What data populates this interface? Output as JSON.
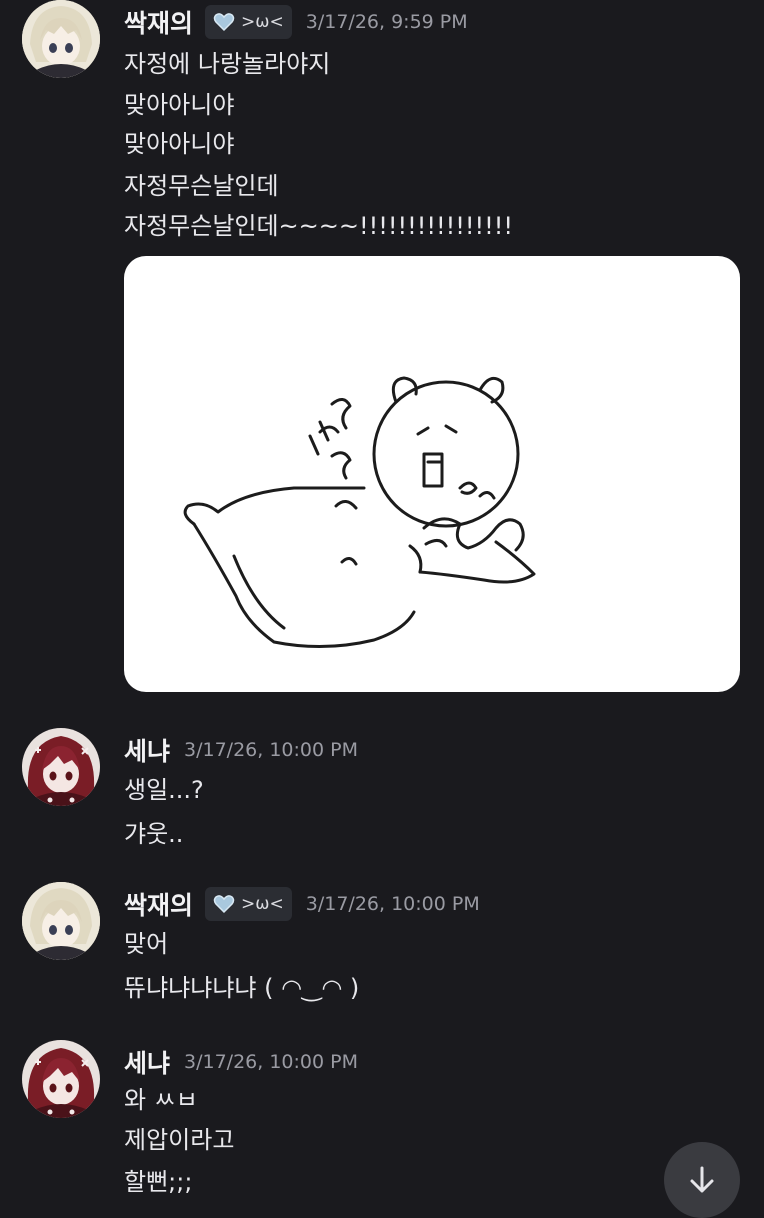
{
  "groups": [
    {
      "username": "싹재의",
      "badge": ">ω<",
      "timestamp": "3/17/26, 9:59 PM",
      "lines": [
        "자정에 나랑놀라야지",
        "맞아아니야",
        "맞아아니야",
        "자정무슨날인데",
        "자정무슨날인데~~~~!!!!!!!!!!!!!!!!"
      ]
    },
    {
      "username": "세냐",
      "timestamp": "3/17/26, 10:00 PM",
      "lines": [
        "생일...?",
        "갸웃.."
      ]
    },
    {
      "username": "싹재의",
      "badge": ">ω<",
      "timestamp": "3/17/26, 10:00 PM",
      "lines": [
        "맞어",
        "뜌냐냐냐냐냐 ( ◠‿◠ )"
      ]
    },
    {
      "username": "세냐",
      "timestamp": "3/17/26, 10:00 PM",
      "lines": [
        "와 ㅆㅂ",
        "제압이라고",
        "할뻔;;;"
      ]
    }
  ],
  "icons": {
    "badge_icon": "heart-icon",
    "scroll_button": "arrow-down-icon"
  },
  "colors": {
    "background": "#1a1a1e",
    "badge_background": "#2b2d33",
    "timestamp": "#9a9ba3"
  }
}
